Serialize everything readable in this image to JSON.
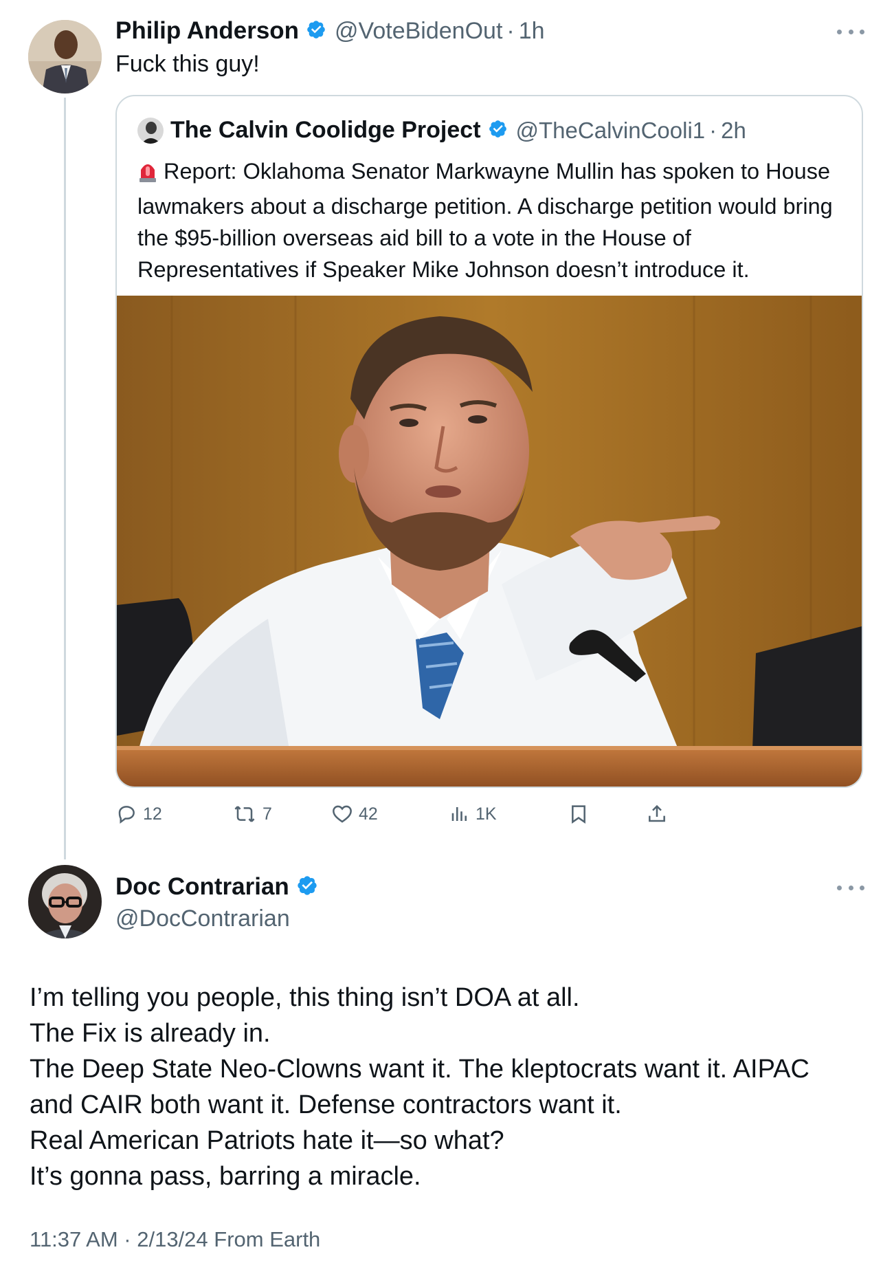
{
  "reply": {
    "author_name": "Philip Anderson",
    "author_handle": "@VoteBidenOut",
    "time": "1h",
    "dot": "·",
    "text": "Fuck this guy!"
  },
  "quote": {
    "author_name": "The Calvin Coolidge Project",
    "author_handle": "@TheCalvinCooli1",
    "time": "2h",
    "dot": "·",
    "text": "Report: Oklahoma Senator Markwayne Mullin has spoken to House lawmakers about a discharge petition. A discharge petition would bring the $95-billion overseas aid bill to a vote in the House of Representatives if Speaker Mike Johnson doesn’t introduce it."
  },
  "actions": {
    "replies": "12",
    "reposts": "7",
    "likes": "42",
    "views": "1K"
  },
  "main": {
    "author_name": "Doc Contrarian",
    "author_handle": "@DocContrarian",
    "lines": [
      "I’m telling you people, this thing isn’t DOA at all.",
      "The Fix is already in.",
      "The Deep State Neo-Clowns want it. The kleptocrats want it. AIPAC",
      "and CAIR both want it. Defense contractors want it.",
      "Real American Patriots hate it—so what?",
      "It’s gonna pass, barring a miracle."
    ],
    "timestamp": "11:37 AM · 2/13/24 From Earth"
  },
  "icons": {
    "verified": "verified-badge-icon",
    "more": "more-icon",
    "reply": "reply-icon",
    "repost": "repost-icon",
    "like": "heart-icon",
    "views": "views-icon",
    "bookmark": "bookmark-icon",
    "share": "share-icon",
    "siren": "siren-emoji-icon"
  },
  "colors": {
    "verified": "#1d9bf0",
    "muted": "#536471",
    "text": "#0f1419",
    "border": "#cfd9de"
  }
}
